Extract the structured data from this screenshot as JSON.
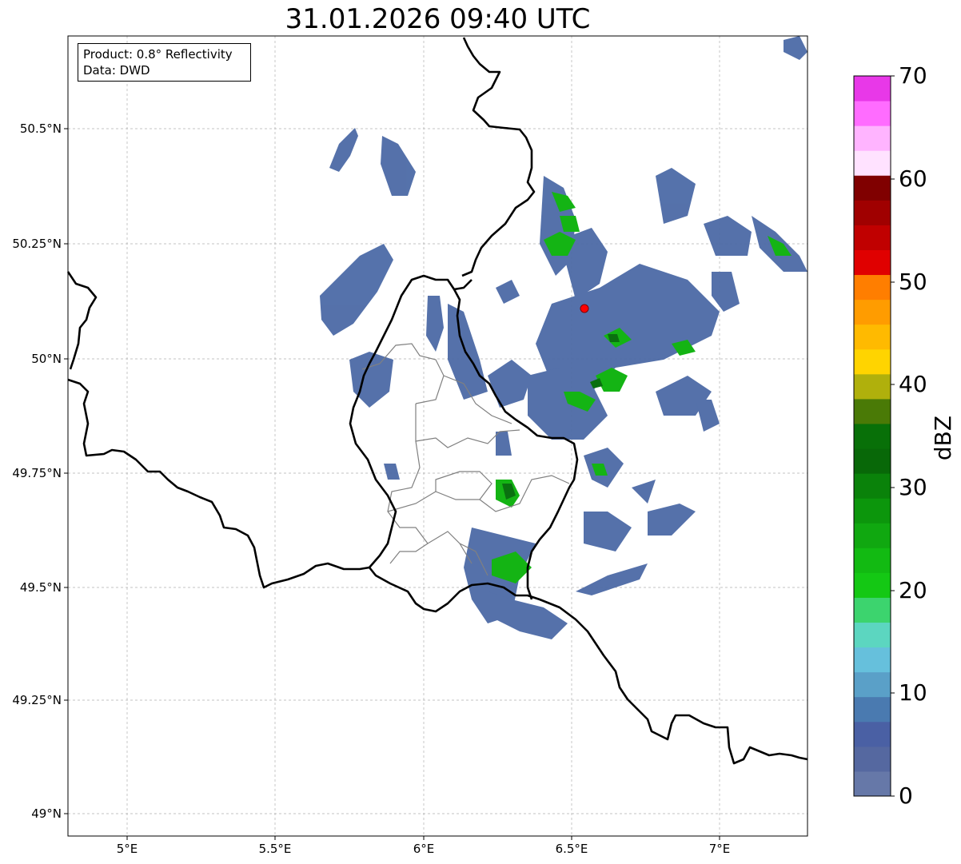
{
  "title": "31.01.2026 09:40 UTC",
  "info_box": {
    "product": "Product: 0.8° Reflectivity",
    "data": "Data: DWD"
  },
  "axes": {
    "lat_ticks": [
      "50.5°N",
      "50.25°N",
      "50°N",
      "49.75°N",
      "49.5°N",
      "49.25°N",
      "49°N"
    ],
    "lon_ticks": [
      "5°E",
      "5.5°E",
      "6°E",
      "6.5°E",
      "7°E"
    ]
  },
  "colorbar": {
    "label": "dBZ",
    "ticks": [
      "0",
      "10",
      "20",
      "30",
      "40",
      "50",
      "60",
      "70"
    ],
    "colors": [
      "#6678a8",
      "#5568a0",
      "#4a60a4",
      "#4a7ab0",
      "#5aa0c8",
      "#66c0dc",
      "#5cd6c0",
      "#3cd46e",
      "#14c814",
      "#12ba12",
      "#10a810",
      "#0c960c",
      "#0a820a",
      "#086808",
      "#087008",
      "#4a7a06",
      "#b0b00c",
      "#ffd400",
      "#ffba00",
      "#ff9c00",
      "#ff7e00",
      "#e00000",
      "#c00000",
      "#a00000",
      "#800000",
      "#ffe2ff",
      "#ffb4ff",
      "#ff6cff",
      "#e838e8"
    ]
  },
  "radar_site": {
    "name": "radar-site",
    "color": "#ff0000"
  }
}
